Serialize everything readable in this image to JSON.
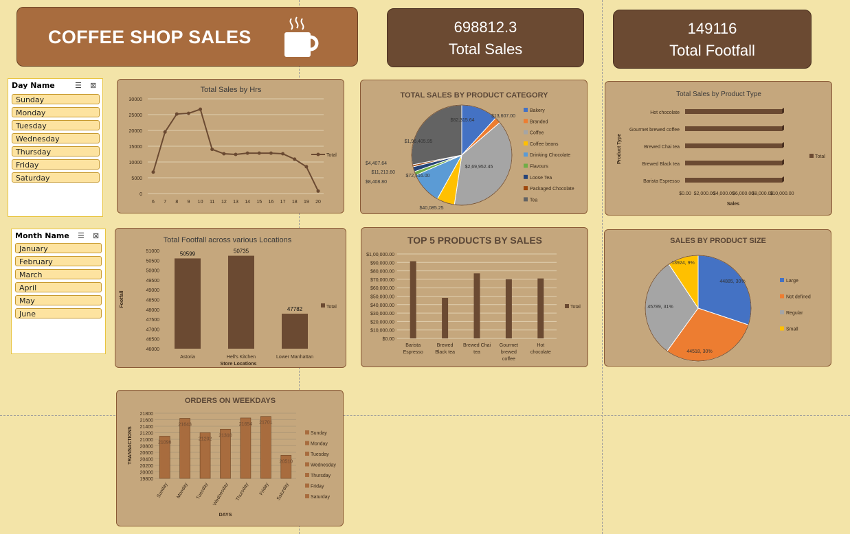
{
  "header": {
    "title": "COFFEE SHOP SALES"
  },
  "kpis": [
    {
      "value": "698812.3",
      "label": "Total Sales"
    },
    {
      "value": "149116",
      "label": "Total Footfall"
    }
  ],
  "slicers": {
    "day": {
      "title": "Day Name",
      "items": [
        "Sunday",
        "Monday",
        "Tuesday",
        "Wednesday",
        "Thursday",
        "Friday",
        "Saturday"
      ]
    },
    "month": {
      "title": "Month Name",
      "items": [
        "January",
        "February",
        "March",
        "April",
        "May",
        "June"
      ]
    }
  },
  "colors": {
    "brown": "#6b4a32",
    "card": "#c5a77d",
    "bg": "#f3e4a8",
    "title": "#a86c3e"
  },
  "chart_data": [
    {
      "id": "hours",
      "type": "line",
      "title": "Total Sales by Hrs",
      "x": [
        6,
        7,
        8,
        9,
        10,
        11,
        12,
        13,
        14,
        15,
        16,
        17,
        18,
        19,
        20
      ],
      "series": [
        {
          "name": "Total",
          "values": [
            6800,
            19500,
            25200,
            25400,
            26700,
            14000,
            12600,
            12400,
            12800,
            12800,
            12800,
            12600,
            10900,
            8500,
            800
          ]
        }
      ],
      "yticks": [
        "0",
        "5000",
        "10000",
        "15000",
        "20000",
        "25000",
        "30000"
      ],
      "ylim": [
        0,
        30000
      ]
    },
    {
      "id": "category",
      "type": "pie",
      "title": "TOTAL SALES BY PRODUCT CATEGORY",
      "categories": [
        "Bakery",
        "Branded",
        "Coffee",
        "Coffee beans",
        "Drinking Chocolate",
        "Flavours",
        "Loose Tea",
        "Packaged Chocolate",
        "Tea"
      ],
      "values": [
        82315.64,
        13607,
        269952.45,
        40085.25,
        72416,
        8408.8,
        11213.6,
        4407.64,
        196405.95
      ],
      "labels": [
        "$82,315.64",
        "$13,607.00",
        "$2,69,952.45",
        "$40,085.25",
        "$72,416.00",
        "$8,408.80",
        "$11,213.60",
        "$4,407.64",
        "$1,96,405.95"
      ],
      "colors": [
        "#4472c4",
        "#ed7d31",
        "#a5a5a5",
        "#ffc000",
        "#5b9bd5",
        "#70ad47",
        "#264478",
        "#9e480e",
        "#636363"
      ]
    },
    {
      "id": "ptype",
      "type": "bar",
      "title": "Total Sales by Product Type",
      "categories": [
        "Hot chocolate",
        "Gourmet brewed coffee",
        "Brewed Chai tea",
        "Brewed Black tea",
        "Barista Espresso"
      ],
      "series": [
        {
          "name": "Total",
          "values": [
            10000,
            10000,
            10000,
            10000,
            10000
          ]
        }
      ],
      "xticks": [
        "$0.00",
        "$2,000.00",
        "$4,000.00",
        "$6,000.00",
        "$8,000.00",
        "$10,000.00"
      ],
      "xlabel": "Sales",
      "ylabel": "Product Type",
      "xlim": [
        0,
        10000
      ]
    },
    {
      "id": "footfall",
      "type": "bar",
      "title": "Total Footfall across various Locations",
      "categories": [
        "Astoria",
        "Hell's Kitchen",
        "Lower Manhattan"
      ],
      "series": [
        {
          "name": "Total",
          "values": [
            50599,
            50735,
            47782
          ]
        }
      ],
      "yticks": [
        "46000",
        "46500",
        "47000",
        "47500",
        "48000",
        "48500",
        "49000",
        "49500",
        "50000",
        "50500",
        "51000"
      ],
      "ylim": [
        46000,
        51000
      ],
      "xlabel": "Store Locations",
      "ylabel": "Footfall"
    },
    {
      "id": "top5",
      "type": "bar",
      "title": "TOP 5 PRODUCTS BY SALES",
      "categories": [
        "Barista Espresso",
        "Brewed Black tea",
        "Brewed Chai tea",
        "Gourmet brewed coffee",
        "Hot chocolate"
      ],
      "catlines": [
        [
          "Barista",
          "Espresso"
        ],
        [
          "Brewed",
          "Black tea"
        ],
        [
          "Brewed Chai",
          "tea"
        ],
        [
          "Gourmet",
          "brewed",
          "coffee"
        ],
        [
          "Hot",
          "chocolate"
        ]
      ],
      "series": [
        {
          "name": "Total",
          "values": [
            91400,
            48000,
            77000,
            70000,
            71000
          ]
        }
      ],
      "yticks": [
        "$0.00",
        "$10,000.00",
        "$20,000.00",
        "$30,000.00",
        "$40,000.00",
        "$50,000.00",
        "$60,000.00",
        "$70,000.00",
        "$80,000.00",
        "$90,000.00",
        "$1,00,000.00"
      ],
      "ylim": [
        0,
        100000
      ]
    },
    {
      "id": "size",
      "type": "pie",
      "title": "SALES BY PRODUCT SIZE",
      "categories": [
        "Large",
        "Not defined",
        "Regular",
        "Small"
      ],
      "values": [
        44885,
        44518,
        45789,
        13924
      ],
      "labels": [
        "44885, 30%",
        "44518, 30%",
        "45789, 31%",
        "13924, 9%"
      ],
      "colors": [
        "#4472c4",
        "#ed7d31",
        "#a5a5a5",
        "#ffc000"
      ]
    },
    {
      "id": "weekdays",
      "type": "bar",
      "title": "ORDERS ON WEEKDAYS",
      "categories": [
        "Sunday",
        "Monday",
        "Tuesday",
        "Wednesday",
        "Thursday",
        "Friday",
        "Saturday"
      ],
      "series": [
        {
          "name": "Total",
          "values": [
            21096,
            21643,
            21202,
            21310,
            21654,
            21701,
            20510
          ]
        }
      ],
      "yticks": [
        "19800",
        "20000",
        "20200",
        "20400",
        "20600",
        "20800",
        "21000",
        "21200",
        "21400",
        "21600",
        "21800"
      ],
      "ylim": [
        19800,
        21800
      ],
      "xlabel": "DAYS",
      "ylabel": "TRANSACTIONS"
    }
  ]
}
